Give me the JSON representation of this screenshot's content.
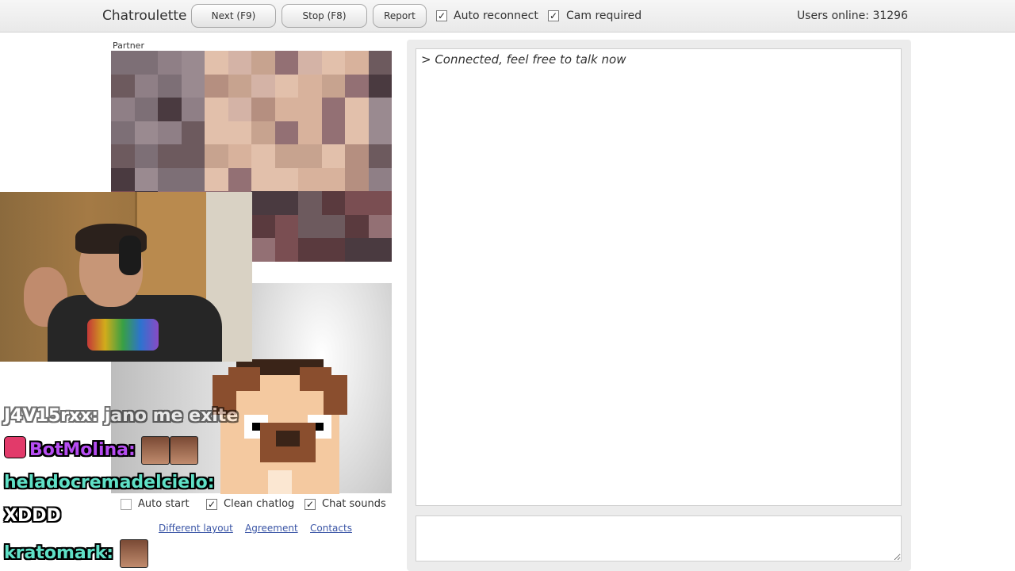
{
  "app": {
    "title": "Chatroulette"
  },
  "toolbar": {
    "next_label": "Next (F9)",
    "stop_label": "Stop (F8)",
    "report_label": "Report",
    "auto_reconnect_label": "Auto reconnect",
    "auto_reconnect_checked": true,
    "cam_required_label": "Cam required",
    "cam_required_checked": true,
    "users_online": "Users online: 31296"
  },
  "video": {
    "partner_label": "Partner"
  },
  "options": {
    "auto_start_label": "Auto start",
    "auto_start_checked": false,
    "clean_chatlog_label": "Clean chatlog",
    "clean_chatlog_checked": true,
    "chat_sounds_label": "Chat sounds",
    "chat_sounds_checked": true
  },
  "links": {
    "different_layout": "Different layout",
    "agreement": "Agreement",
    "contacts": "Contacts"
  },
  "chat": {
    "messages": [
      "> Connected, feel free to talk now"
    ],
    "input_value": ""
  },
  "stream_overlay": {
    "line1": "J4V15rxx: jano me exite",
    "line2_user": "BotMolina:",
    "line3_user": "heladocremadelcielo:",
    "line4_text": "XDDD",
    "line5_user": "kratomark:"
  },
  "colors": {
    "accent_link": "#3a55a6",
    "overlay_purple": "#b64df2",
    "overlay_teal": "#5fe0c6"
  }
}
